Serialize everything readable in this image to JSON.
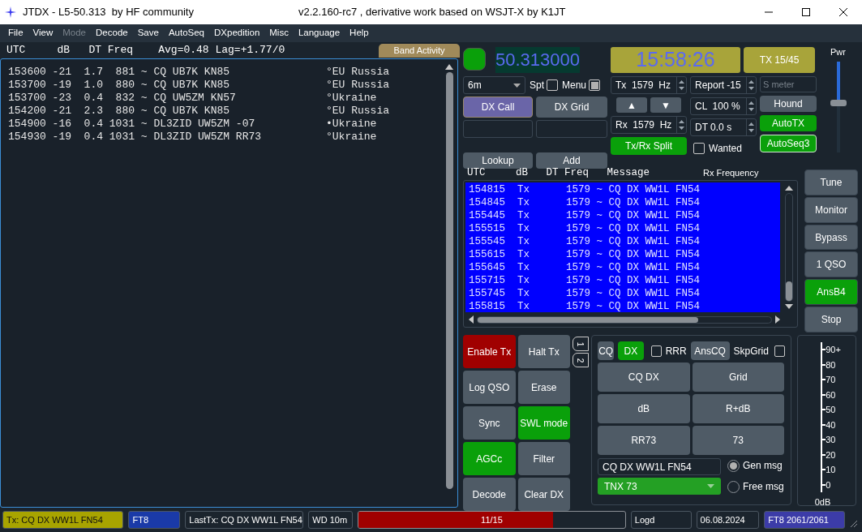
{
  "window": {
    "title": "JTDX - L5-50.313  by HF community",
    "subtitle": "v2.2.160-rc7 , derivative work based on WSJT-X by K1JT"
  },
  "menu": [
    {
      "label": "File",
      "disabled": false
    },
    {
      "label": "View",
      "disabled": false
    },
    {
      "label": "Mode",
      "disabled": true
    },
    {
      "label": "Decode",
      "disabled": false
    },
    {
      "label": "Save",
      "disabled": false
    },
    {
      "label": "AutoSeq",
      "disabled": false
    },
    {
      "label": "DXpedition",
      "disabled": false
    },
    {
      "label": "Misc",
      "disabled": false
    },
    {
      "label": "Language",
      "disabled": false
    },
    {
      "label": "Help",
      "disabled": false
    }
  ],
  "band_activity": {
    "header": "UTC     dB   DT Freq    Avg=0.48 Lag=+1.77/0",
    "button": "Band Activity",
    "rows": [
      {
        "text": "153600 -21  1.7  881 ~ CQ UB7K KN85",
        "country": "°EU Russia"
      },
      {
        "text": "153700 -19  1.0  880 ~ CQ UB7K KN85",
        "country": "°EU Russia"
      },
      {
        "text": "153700 -23  0.4  832 ~ CQ UW5ZM KN57",
        "country": "°Ukraine"
      },
      {
        "text": "154200 -21  2.3  880 ~ CQ UB7K KN85",
        "country": "°EU Russia"
      },
      {
        "text": "154900 -16  0.4 1031 ~ DL3ZID UW5ZM -07",
        "country": "•Ukraine"
      },
      {
        "text": "154930 -19  0.4 1031 ~ DL3ZID UW5ZM RR73",
        "country": "°Ukraine"
      }
    ]
  },
  "station": {
    "frequency": "50.313000",
    "clock": "15:58:26",
    "tx_period": {
      "label": "TX 15/45"
    },
    "band": "6m",
    "checkboxes": [
      {
        "label": "Spt",
        "checked": false
      },
      {
        "label": "Menu",
        "checked": true
      }
    ],
    "dx_call": {
      "label": "DX Call",
      "on": true,
      "kind": "call"
    },
    "dx_grid": {
      "label": "DX Grid",
      "on": false
    },
    "lookup": {
      "label": "Lookup"
    },
    "add": {
      "label": "Add"
    },
    "tx_freq": "Tx  1579  Hz",
    "rx_freq": "Rx  1579  Hz",
    "report": "Report -15",
    "cl": "CL  100 %",
    "dt": "DT 0.0 s",
    "s_meter_placeholder": "S meter",
    "up": "▲",
    "down": "▼",
    "split": {
      "label": "Tx/Rx Split",
      "on": true
    },
    "wanted": {
      "label": "Wanted",
      "checked": false
    },
    "hound": {
      "label": "Hound",
      "on": false
    },
    "autotx": {
      "label": "AutoTX",
      "on": true
    },
    "autoseq": {
      "label": "AutoSeq3",
      "on": true
    },
    "power": {
      "label": "Pwr",
      "level": 0.55
    }
  },
  "rx_frequency": {
    "header": "UTC     dB   DT Freq   Message",
    "title": "Rx Frequency",
    "rows": [
      "154815  Tx      1579 ~ CQ DX WW1L FN54",
      "154845  Tx      1579 ~ CQ DX WW1L FN54",
      "155445  Tx      1579 ~ CQ DX WW1L FN54",
      "155515  Tx      1579 ~ CQ DX WW1L FN54",
      "155545  Tx      1579 ~ CQ DX WW1L FN54",
      "155615  Tx      1579 ~ CQ DX WW1L FN54",
      "155645  Tx      1579 ~ CQ DX WW1L FN54",
      "155715  Tx      1579 ~ CQ DX WW1L FN54",
      "155745  Tx      1579 ~ CQ DX WW1L FN54",
      "155815  Tx      1579 ~ CQ DX WW1L FN54"
    ]
  },
  "side_buttons": [
    {
      "label": "Tune",
      "on": false
    },
    {
      "label": "Monitor",
      "on": false
    },
    {
      "label": "Bypass",
      "on": false
    },
    {
      "label": "1 QSO",
      "on": false
    },
    {
      "label": "AnsB4",
      "on": true
    },
    {
      "label": "Stop",
      "on": false
    }
  ],
  "control_buttons": [
    {
      "label": "Enable Tx",
      "on": true,
      "kind": "enable"
    },
    {
      "label": "Halt Tx",
      "on": false
    },
    {
      "label": "Log QSO",
      "on": false
    },
    {
      "label": "Erase",
      "on": false
    },
    {
      "label": "Sync",
      "on": false
    },
    {
      "label": "SWL mode",
      "on": true
    },
    {
      "label": "AGCc",
      "on": true
    },
    {
      "label": "Filter",
      "on": false
    },
    {
      "label": "Decode",
      "on": false
    },
    {
      "label": "Clear DX",
      "on": false
    }
  ],
  "tx_tabs": [
    {
      "label": "1"
    },
    {
      "label": "2"
    }
  ],
  "tx_panel": {
    "cq": {
      "label": "CQ",
      "on": false
    },
    "dx": {
      "label": "DX",
      "on": true
    },
    "rrr": {
      "label": "RRR",
      "checked": false
    },
    "anscq": {
      "label": "AnsCQ",
      "on": false
    },
    "skpgrid": {
      "label": "SkpGrid",
      "checked": false
    },
    "messages": [
      "CQ DX",
      "Grid",
      "dB",
      "R+dB",
      "RR73",
      "73"
    ],
    "message_field": "CQ DX WW1L FN54",
    "free_message": "TNX 73",
    "radios": [
      {
        "label": "Gen msg",
        "selected": true
      },
      {
        "label": "Free msg",
        "selected": false
      }
    ]
  },
  "meter": {
    "ticks": [
      "90+",
      "80",
      "70",
      "60",
      "50",
      "40",
      "30",
      "20",
      "10",
      "0"
    ],
    "unit": "0dB"
  },
  "status_bar": [
    {
      "kind": "tx",
      "text": "Tx: CQ DX WW1L FN54"
    },
    {
      "kind": "mode",
      "text": "FT8"
    },
    {
      "kind": "plain",
      "text": "LastTx: CQ DX WW1L FN54"
    },
    {
      "kind": "plain",
      "text": "WD 10m"
    },
    {
      "kind": "progress",
      "text": "11/15",
      "level": 0.73
    },
    {
      "kind": "plain",
      "text": "Logd"
    },
    {
      "kind": "plain",
      "text": "06.08.2024"
    },
    {
      "kind": "decodes",
      "text": "FT8  2061/2061"
    }
  ]
}
